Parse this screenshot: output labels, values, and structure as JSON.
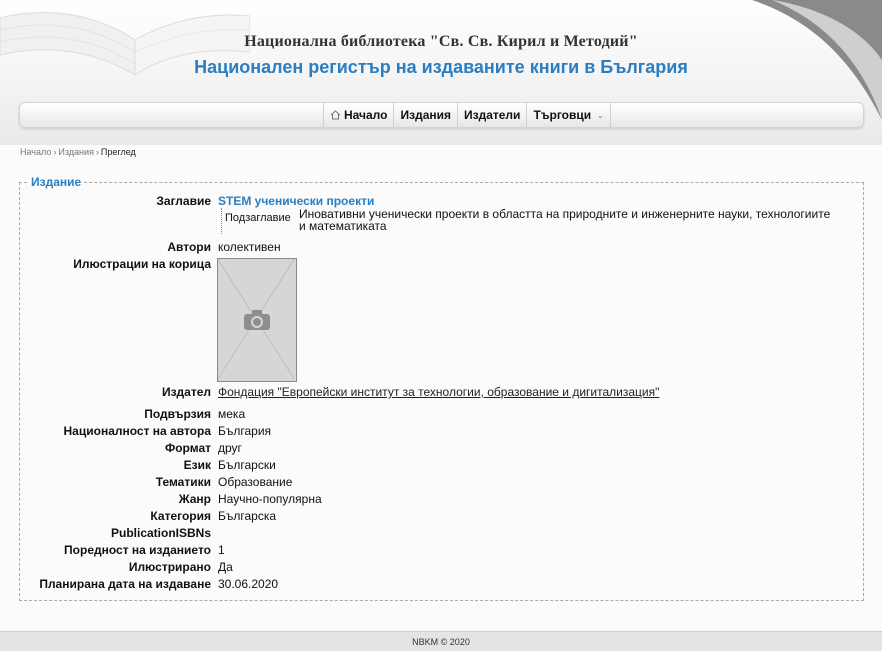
{
  "header": {
    "library_name": "Национална библиотека \"Св. Св. Кирил и Методий\"",
    "register_name": "Национален регистър на издаваните книги в България"
  },
  "nav": {
    "items": [
      {
        "label": "Начало",
        "icon": "home-icon"
      },
      {
        "label": "Издания"
      },
      {
        "label": "Издатели"
      },
      {
        "label": "Търговци",
        "icon": "chevron-down-icon"
      }
    ]
  },
  "breadcrumb": {
    "home": "Начало",
    "section": "Издания",
    "current": "Преглед"
  },
  "edition": {
    "legend": "Издание",
    "title_label": "Заглавие",
    "title_value": "STEM ученически проекти",
    "subtitle_label": "Подзаглавие",
    "subtitle_value": "Иновативни ученически проекти в областта на природните и инженерните науки, технологиите и математиката",
    "authors_label": "Автори",
    "authors_value": "колективен",
    "cover_label": "Илюстрации на корица",
    "cover_icon": "camera-icon",
    "publisher_label": "Издател",
    "publisher_value": "Фондация \"Европейски институт за технологии, образование и дигитализация\"",
    "fields": [
      {
        "label": "Подвързия",
        "value": "мека"
      },
      {
        "label": "Националност на автора",
        "value": "България"
      },
      {
        "label": "Формат",
        "value": "друг"
      },
      {
        "label": "Език",
        "value": "Български"
      },
      {
        "label": "Тематики",
        "value": "Образование"
      },
      {
        "label": "Жанр",
        "value": "Научно-популярна"
      },
      {
        "label": "Категория",
        "value": "Българска"
      },
      {
        "label": "PublicationISBNs",
        "value": ""
      },
      {
        "label": "Поредност на изданието",
        "value": "1"
      },
      {
        "label": "Илюстрирано",
        "value": "Да"
      },
      {
        "label": "Планирана дата на издаване",
        "value": "30.06.2020"
      }
    ]
  },
  "footer": {
    "text": "NBKM © 2020"
  },
  "colors": {
    "accent": "#2b7ec1",
    "footer_bg": "#e4e4e4"
  }
}
